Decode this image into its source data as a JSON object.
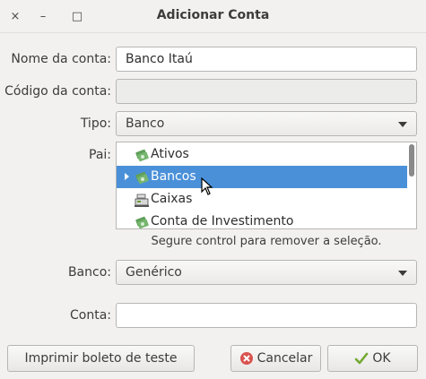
{
  "window": {
    "title": "Adicionar Conta",
    "controls": {
      "close": "×",
      "minimize": "–",
      "maximize": "□"
    }
  },
  "form": {
    "nome": {
      "label": "Nome da conta:",
      "value": "Banco Itaú"
    },
    "codigo": {
      "label": "Código da conta:",
      "value": ""
    },
    "tipo": {
      "label": "Tipo:",
      "value": "Banco"
    },
    "pai": {
      "label": "Pai:",
      "items": [
        {
          "label": "Ativos",
          "icon": "money-icon"
        },
        {
          "label": "Bancos",
          "icon": "money-icon",
          "selected": true
        },
        {
          "label": "Caixas",
          "icon": "cash-register-icon"
        },
        {
          "label": "Conta de Investimento",
          "icon": "money-icon"
        }
      ],
      "hint": "Segure control para remover a seleção."
    },
    "banco": {
      "label": "Banco:",
      "value": "Genérico"
    },
    "conta": {
      "label": "Conta:",
      "value": ""
    }
  },
  "buttons": {
    "print": "Imprimir boleto de teste",
    "cancel": "Cancelar",
    "ok": "OK"
  },
  "colors": {
    "selection": "#4a90d9",
    "cancel_icon": "#d9534f",
    "ok_icon": "#73a832"
  }
}
